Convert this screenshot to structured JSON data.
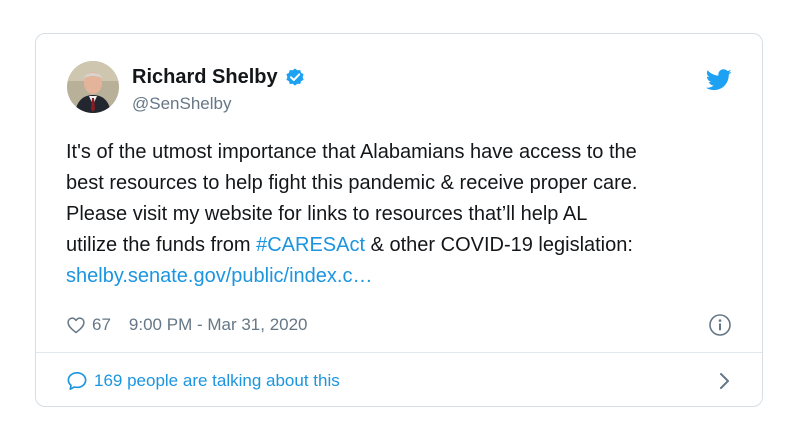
{
  "author": {
    "name": "Richard Shelby",
    "handle": "@SenShelby",
    "verified": true
  },
  "tweet": {
    "line1": "It's of the utmost importance that Alabamians have access to the",
    "line2": "best resources to help fight this pandemic & receive proper care.",
    "line3": "Please visit my website for links to resources that’ll help AL",
    "line4_before": "utilize the funds from ",
    "hashtag": "#CARESAct",
    "line4_after": " & other COVID-19 legislation:",
    "url": "shelby.senate.gov/public/index.c…"
  },
  "meta": {
    "likes": "67",
    "timestamp": "9:00 PM - Mar 31, 2020"
  },
  "footer": {
    "talking": "169 people are talking about this"
  },
  "icons": {
    "verified": "verified-badge-icon",
    "logo": "twitter-bird-icon",
    "like": "heart-icon",
    "info": "info-icon",
    "reply": "speech-bubble-icon",
    "more": "chevron-right-icon"
  },
  "colors": {
    "link": "#1b95e0",
    "text": "#14171a",
    "muted": "#657786",
    "border": "#d6dee4"
  }
}
